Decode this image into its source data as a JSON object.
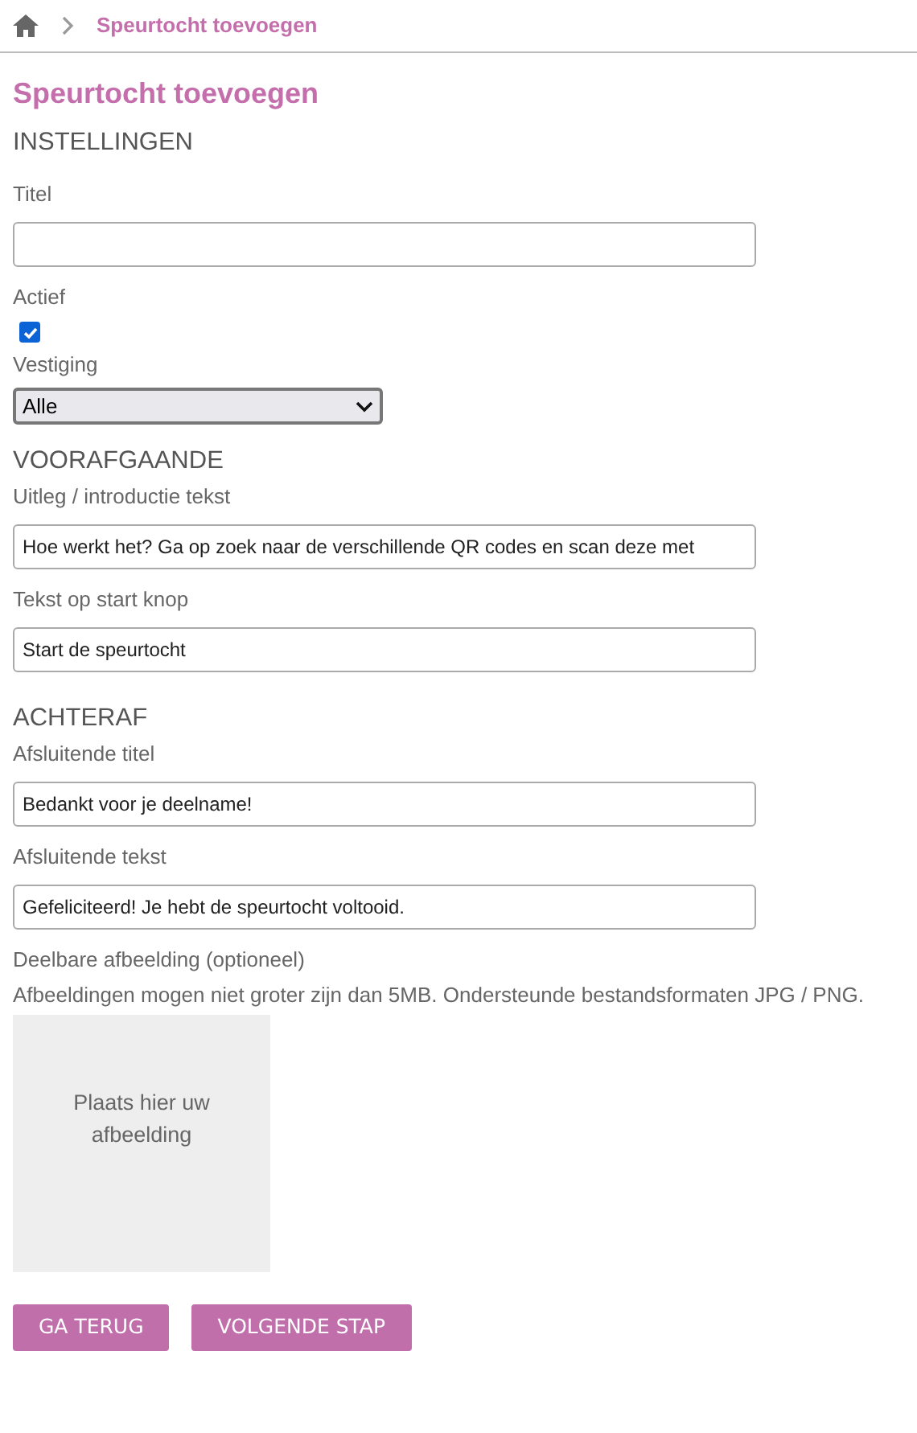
{
  "breadcrumb": {
    "current": "Speurtocht toevoegen"
  },
  "page_title": "Speurtocht toevoegen",
  "sections": [
    {
      "heading": "INSTELLINGEN",
      "fields": [
        {
          "kind": "text",
          "label": "Titel"
        },
        {
          "kind": "checkbox",
          "label": "Actief",
          "checked": true
        },
        {
          "kind": "select",
          "label": "Vestiging",
          "value": "Alle"
        }
      ]
    },
    {
      "heading": "VOORAFGAANDE",
      "fields": [
        {
          "kind": "text",
          "label": "Uitleg / introductie tekst",
          "value": "Hoe werkt het? Ga op zoek naar de verschillende QR codes en scan deze met"
        },
        {
          "kind": "text",
          "label": "Tekst op start knop",
          "value": "Start de speurtocht"
        }
      ]
    },
    {
      "heading": "ACHTERAF",
      "fields": [
        {
          "kind": "text",
          "label": "Afsluitende titel",
          "value": "Bedankt voor je deelname!"
        },
        {
          "kind": "text",
          "label": "Afsluitende tekst",
          "value": "Gefeliciteerd! Je hebt de speurtocht voltooid."
        },
        {
          "kind": "upload",
          "label": "Deelbare afbeelding (optioneel)",
          "hint": "Afbeeldingen mogen niet groter zijn dan 5MB. Ondersteunde bestandsformaten JPG / PNG.",
          "dropzone_text": "Plaats hier uw afbeelding"
        }
      ]
    }
  ],
  "buttons": [
    "GA TERUG",
    "VOLGENDE STAP"
  ]
}
